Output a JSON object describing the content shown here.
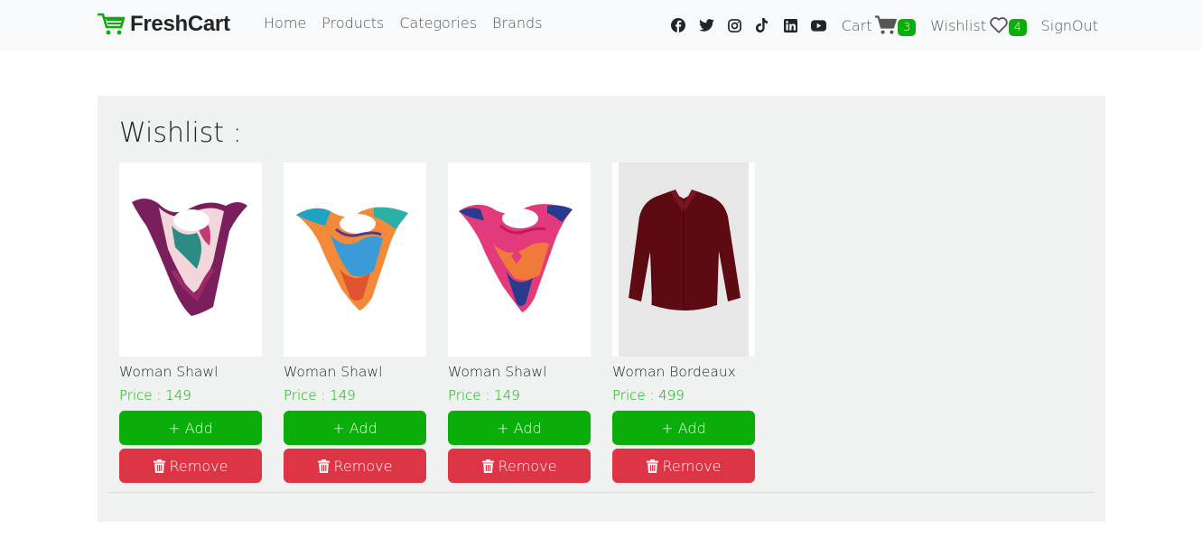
{
  "brand": {
    "name": "FreshCart",
    "logo_icon": "cart-logo-icon",
    "color": "#0aad0a"
  },
  "nav": {
    "links": [
      "Home",
      "Products",
      "Categories",
      "Brands"
    ],
    "social_icons": [
      "facebook-icon",
      "twitter-icon",
      "instagram-icon",
      "tiktok-icon",
      "linkedin-icon",
      "youtube-icon"
    ],
    "cart": {
      "label": "Cart",
      "count": "3"
    },
    "wishlist": {
      "label": "Wishlist",
      "count": "4"
    },
    "signout": "SignOut"
  },
  "wishlist": {
    "title": "Wishlist :",
    "items": [
      {
        "name": "Woman Shawl",
        "price": "Price : 149",
        "add_label": "+ Add",
        "remove_label": "Remove",
        "image": "purple-pink-shawl"
      },
      {
        "name": "Woman Shawl",
        "price": "Price : 149",
        "add_label": "+ Add",
        "remove_label": "Remove",
        "image": "orange-teal-shawl"
      },
      {
        "name": "Woman Shawl",
        "price": "Price : 149",
        "add_label": "+ Add",
        "remove_label": "Remove",
        "image": "pink-navy-shawl"
      },
      {
        "name": "Woman Bordeaux",
        "price": "Price : 499",
        "add_label": "+ Add",
        "remove_label": "Remove",
        "image": "bordeaux-blouse"
      }
    ]
  },
  "colors": {
    "accent": "#0aad0a",
    "danger": "#dc3545",
    "panel": "#f0f2f1",
    "navbar": "#f8f9fa"
  }
}
